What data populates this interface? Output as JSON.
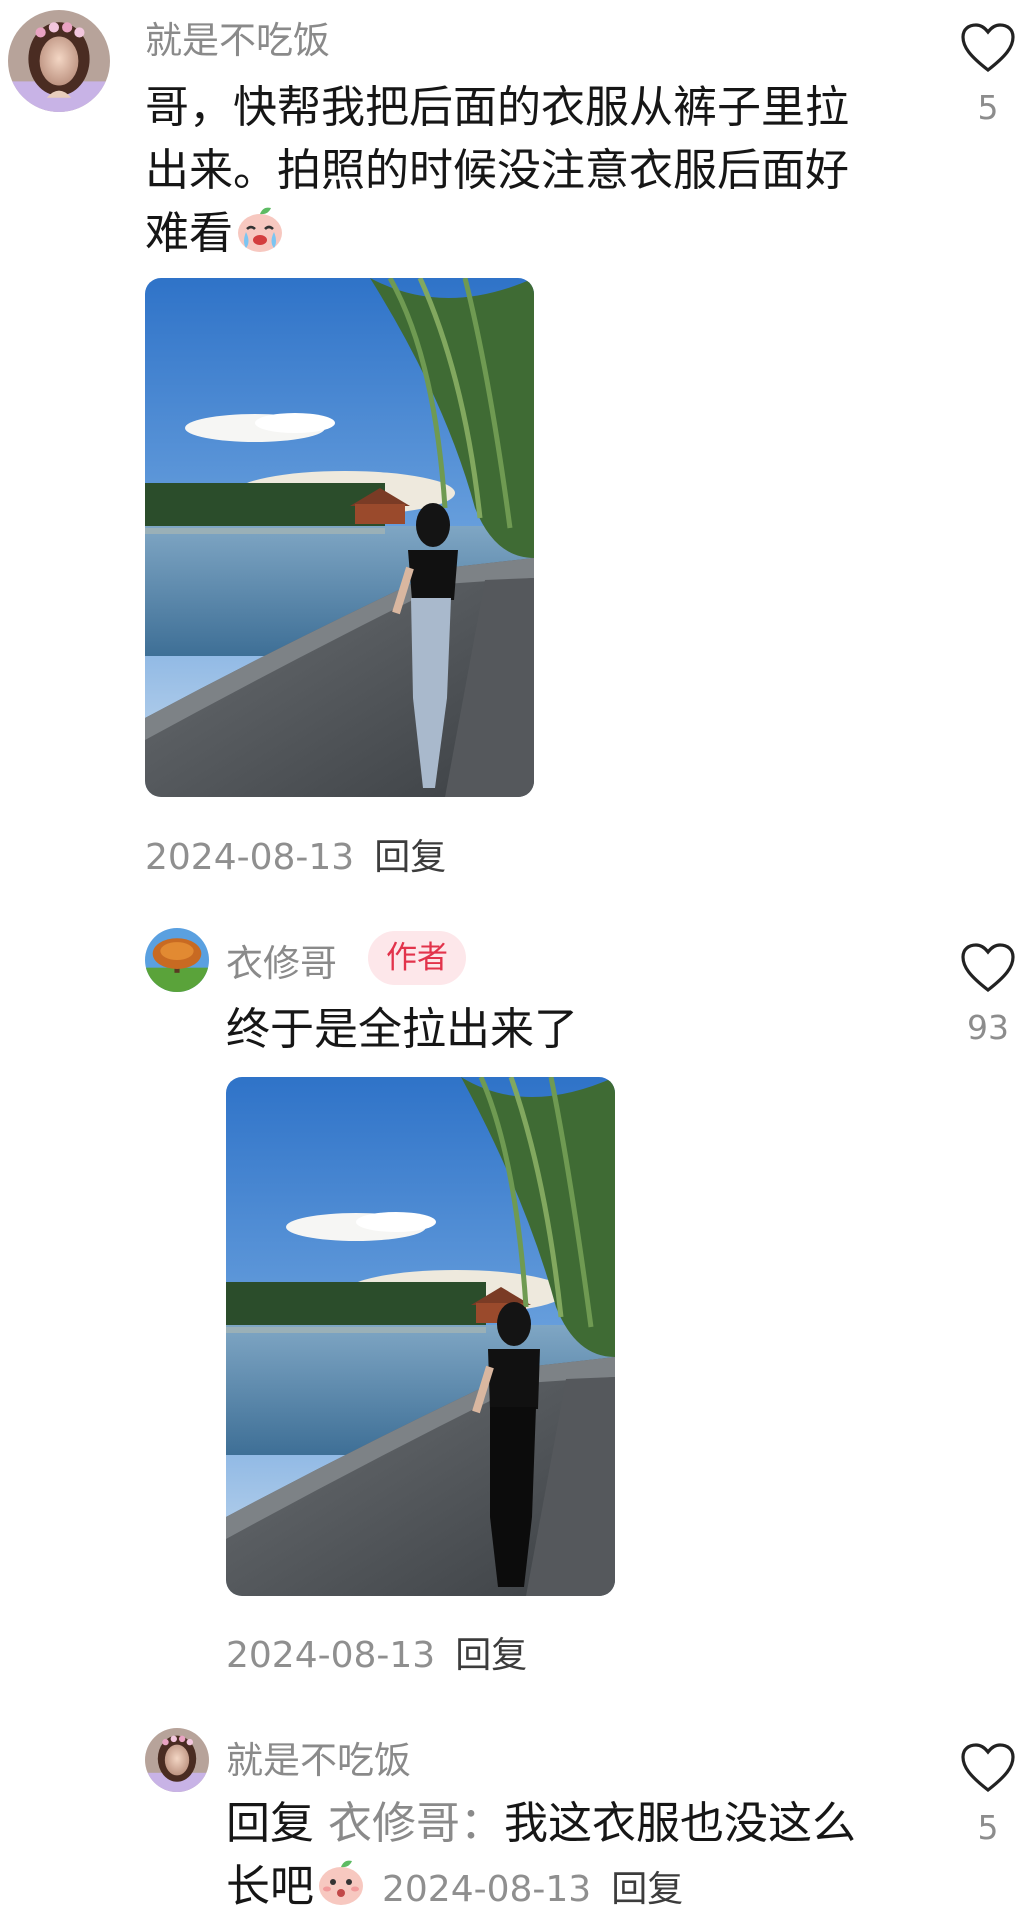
{
  "comments": [
    {
      "username": "就是不吃饭",
      "text_lines": [
        "哥，快帮我把后面的衣服从裤子里拉",
        "出来。拍照的时候没注意衣服后面好",
        "难看"
      ],
      "date": "2024-08-13",
      "reply_label": "回复",
      "likes": "5",
      "emoji": "crying-peach-emoji",
      "photo": "tucked-shirt-photo"
    },
    {
      "username": "衣修哥",
      "badge": "作者",
      "text": "终于是全拉出来了",
      "date": "2024-08-13",
      "reply_label": "回复",
      "likes": "93",
      "photo": "untucked-shirt-photo"
    },
    {
      "username": "就是不吃饭",
      "reply_prefix": "回复",
      "reply_to": "衣修哥：",
      "text_a": "我这衣服也没这么",
      "text_b": "长吧",
      "date": "2024-08-13",
      "reply_label": "回复",
      "likes": "5",
      "emoji": "surprised-peach-emoji"
    }
  ],
  "colors": {
    "badge_bg": "#fde7ea",
    "badge_text": "#e2334b",
    "meta": "#8f8f8f"
  }
}
